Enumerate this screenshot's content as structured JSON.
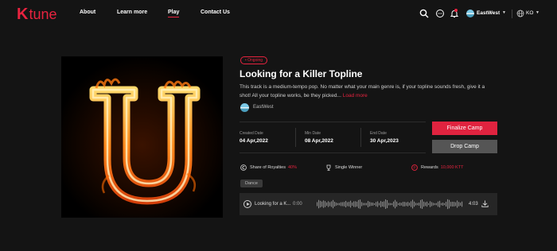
{
  "brand": {
    "logo_k": "K",
    "logo_text": "tune",
    "accent": "#e8233f"
  },
  "nav": [
    {
      "label": "About"
    },
    {
      "label": "Learn more"
    },
    {
      "label": "Play",
      "active": true
    },
    {
      "label": "Contact Us"
    }
  ],
  "header": {
    "icons": [
      "search-icon",
      "chat-icon",
      "bell-icon"
    ],
    "user": {
      "name": "EastWest"
    },
    "language": "KO"
  },
  "camp": {
    "status": "• Ongoing",
    "title": "Looking for a Killer Topline",
    "description": "This track is a medium-tempo pop. No matter what your main genre is, if your topline sounds fresh, give it a shot! All your topline works, be they picked...",
    "load_more": "Load more",
    "owner": "EastWest",
    "dates": [
      {
        "label": "Created Date",
        "value": "04 Apr,2022"
      },
      {
        "label": "Min Date",
        "value": "08 Apr,2022"
      },
      {
        "label": "End Date",
        "value": "30 Apr,2023"
      }
    ],
    "finalize_label": "Finalize Camp",
    "drop_label": "Drop Camp",
    "royalties_label": "Share of Royalties",
    "royalties_value": "40%",
    "winner_label": "Single Winner",
    "rewards_label": "Rewards",
    "rewards_value": "10,000 KTT",
    "tag": "Dance"
  },
  "player": {
    "track": "Looking for a K...",
    "time_start": "0:00",
    "time_end": "4:03"
  }
}
